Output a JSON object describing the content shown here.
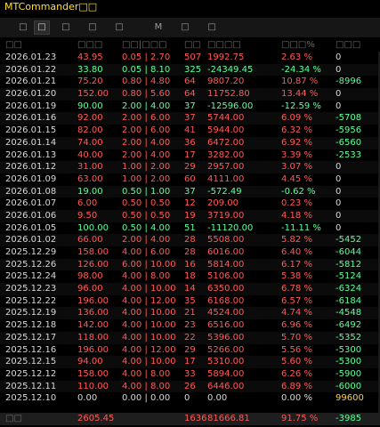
{
  "window": {
    "title": "MTCommander□□"
  },
  "toolbar": {
    "buttons": [
      "□",
      "□",
      "□",
      "□",
      "□",
      "M",
      "□",
      "□"
    ],
    "active_index": 1
  },
  "table": {
    "headers": [
      "□□",
      "□□□",
      "□□|□□□",
      "□□",
      "□□□□",
      "□□□%",
      "□□□"
    ],
    "rows": [
      {
        "date": "2026.01.23",
        "a": "43.95",
        "b": "0.05 | 2.70",
        "n": "507",
        "v": "1992.75",
        "p": "2.63 %",
        "d": "0",
        "tone": "red"
      },
      {
        "date": "2026.01.22",
        "a": "33.80",
        "b": "0.05 | 8.10",
        "n": "325",
        "v": "-24349.45",
        "p": "-24.34 %",
        "d": "0",
        "tone": "green"
      },
      {
        "date": "2026.01.21",
        "a": "75.20",
        "b": "0.80 | 4.80",
        "n": "64",
        "v": "9807.20",
        "p": "10.87 %",
        "d": "-8996",
        "tone": "red"
      },
      {
        "date": "2026.01.20",
        "a": "152.00",
        "b": "0.80 | 5.60",
        "n": "64",
        "v": "11752.80",
        "p": "13.44 %",
        "d": "0",
        "tone": "red"
      },
      {
        "date": "2026.01.19",
        "a": "90.00",
        "b": "2.00 | 4.00",
        "n": "37",
        "v": "-12596.00",
        "p": "-12.59 %",
        "d": "0",
        "tone": "green"
      },
      {
        "date": "2026.01.16",
        "a": "92.00",
        "b": "2.00 | 6.00",
        "n": "37",
        "v": "5744.00",
        "p": "6.09 %",
        "d": "-5708",
        "tone": "red"
      },
      {
        "date": "2026.01.15",
        "a": "82.00",
        "b": "2.00 | 6.00",
        "n": "41",
        "v": "5944.00",
        "p": "6.32 %",
        "d": "-5956",
        "tone": "red"
      },
      {
        "date": "2026.01.14",
        "a": "74.00",
        "b": "2.00 | 4.00",
        "n": "36",
        "v": "6472.00",
        "p": "6.92 %",
        "d": "-6560",
        "tone": "red"
      },
      {
        "date": "2026.01.13",
        "a": "40.00",
        "b": "2.00 | 4.00",
        "n": "17",
        "v": "3282.00",
        "p": "3.39 %",
        "d": "-2533",
        "tone": "red"
      },
      {
        "date": "2026.01.12",
        "a": "31.00",
        "b": "1.00 | 2.00",
        "n": "29",
        "v": "2957.00",
        "p": "3.07 %",
        "d": "0",
        "tone": "red"
      },
      {
        "date": "2026.01.09",
        "a": "63.00",
        "b": "1.00 | 2.00",
        "n": "60",
        "v": "4111.00",
        "p": "4.45 %",
        "d": "0",
        "tone": "red"
      },
      {
        "date": "2026.01.08",
        "a": "19.00",
        "b": "0.50 | 1.00",
        "n": "37",
        "v": "-572.49",
        "p": "-0.62 %",
        "d": "0",
        "tone": "green"
      },
      {
        "date": "2026.01.07",
        "a": "6.00",
        "b": "0.50 | 0.50",
        "n": "12",
        "v": "209.00",
        "p": "0.23 %",
        "d": "0",
        "tone": "red"
      },
      {
        "date": "2026.01.06",
        "a": "9.50",
        "b": "0.50 | 0.50",
        "n": "19",
        "v": "3719.00",
        "p": "4.18 %",
        "d": "0",
        "tone": "red"
      },
      {
        "date": "2026.01.05",
        "a": "100.00",
        "b": "0.50 | 4.00",
        "n": "51",
        "v": "-11120.00",
        "p": "-11.11 %",
        "d": "0",
        "tone": "green"
      },
      {
        "date": "2026.01.02",
        "a": "66.00",
        "b": "2.00 | 4.00",
        "n": "28",
        "v": "5508.00",
        "p": "5.82 %",
        "d": "-5452",
        "tone": "red"
      },
      {
        "date": "2025.12.29",
        "a": "158.00",
        "b": "4.00 | 6.00",
        "n": "28",
        "v": "6016.00",
        "p": "6.40 %",
        "d": "-6044",
        "tone": "red"
      },
      {
        "date": "2025.12.26",
        "a": "126.00",
        "b": "6.00 | 10.00",
        "n": "16",
        "v": "5814.00",
        "p": "6.17 %",
        "d": "-5812",
        "tone": "red"
      },
      {
        "date": "2025.12.24",
        "a": "98.00",
        "b": "4.00 | 8.00",
        "n": "18",
        "v": "5106.00",
        "p": "5.38 %",
        "d": "-5124",
        "tone": "red"
      },
      {
        "date": "2025.12.23",
        "a": "96.00",
        "b": "4.00 | 10.00",
        "n": "14",
        "v": "6350.00",
        "p": "6.78 %",
        "d": "-6324",
        "tone": "red"
      },
      {
        "date": "2025.12.22",
        "a": "196.00",
        "b": "4.00 | 12.00",
        "n": "35",
        "v": "6168.00",
        "p": "6.57 %",
        "d": "-6184",
        "tone": "red"
      },
      {
        "date": "2025.12.19",
        "a": "136.00",
        "b": "4.00 | 10.00",
        "n": "21",
        "v": "4524.00",
        "p": "4.74 %",
        "d": "-4548",
        "tone": "red"
      },
      {
        "date": "2025.12.18",
        "a": "142.00",
        "b": "4.00 | 10.00",
        "n": "23",
        "v": "6516.00",
        "p": "6.96 %",
        "d": "-6492",
        "tone": "red"
      },
      {
        "date": "2025.12.17",
        "a": "118.00",
        "b": "4.00 | 10.00",
        "n": "22",
        "v": "5396.00",
        "p": "5.70 %",
        "d": "-5352",
        "tone": "red"
      },
      {
        "date": "2025.12.16",
        "a": "196.00",
        "b": "4.00 | 12.00",
        "n": "29",
        "v": "5266.00",
        "p": "5.56 %",
        "d": "-5300",
        "tone": "red"
      },
      {
        "date": "2025.12.15",
        "a": "94.00",
        "b": "4.00 | 10.00",
        "n": "17",
        "v": "5310.00",
        "p": "5.60 %",
        "d": "-5300",
        "tone": "red"
      },
      {
        "date": "2025.12.12",
        "a": "158.00",
        "b": "4.00 | 8.00",
        "n": "33",
        "v": "5894.00",
        "p": "6.26 %",
        "d": "-5900",
        "tone": "red"
      },
      {
        "date": "2025.12.11",
        "a": "110.00",
        "b": "4.00 | 8.00",
        "n": "26",
        "v": "6446.00",
        "p": "6.89 %",
        "d": "-6000",
        "tone": "red"
      },
      {
        "date": "2025.12.10",
        "a": "0.00",
        "b": "0.00 | 0.00",
        "n": "0",
        "v": "0.00",
        "p": "0.00 %",
        "d": "99600",
        "tone": "white"
      }
    ],
    "footer": {
      "label": "□□",
      "a": "2605.45",
      "n": "1636",
      "v": "81666.81",
      "p": "91.75 %",
      "d": "-3985"
    }
  },
  "colors": {
    "loss": "#ff5a5a",
    "gain": "#5cff9b",
    "neutral": "#d8d8d8",
    "highlight": "#ffd23c",
    "title": "#ffe033"
  }
}
